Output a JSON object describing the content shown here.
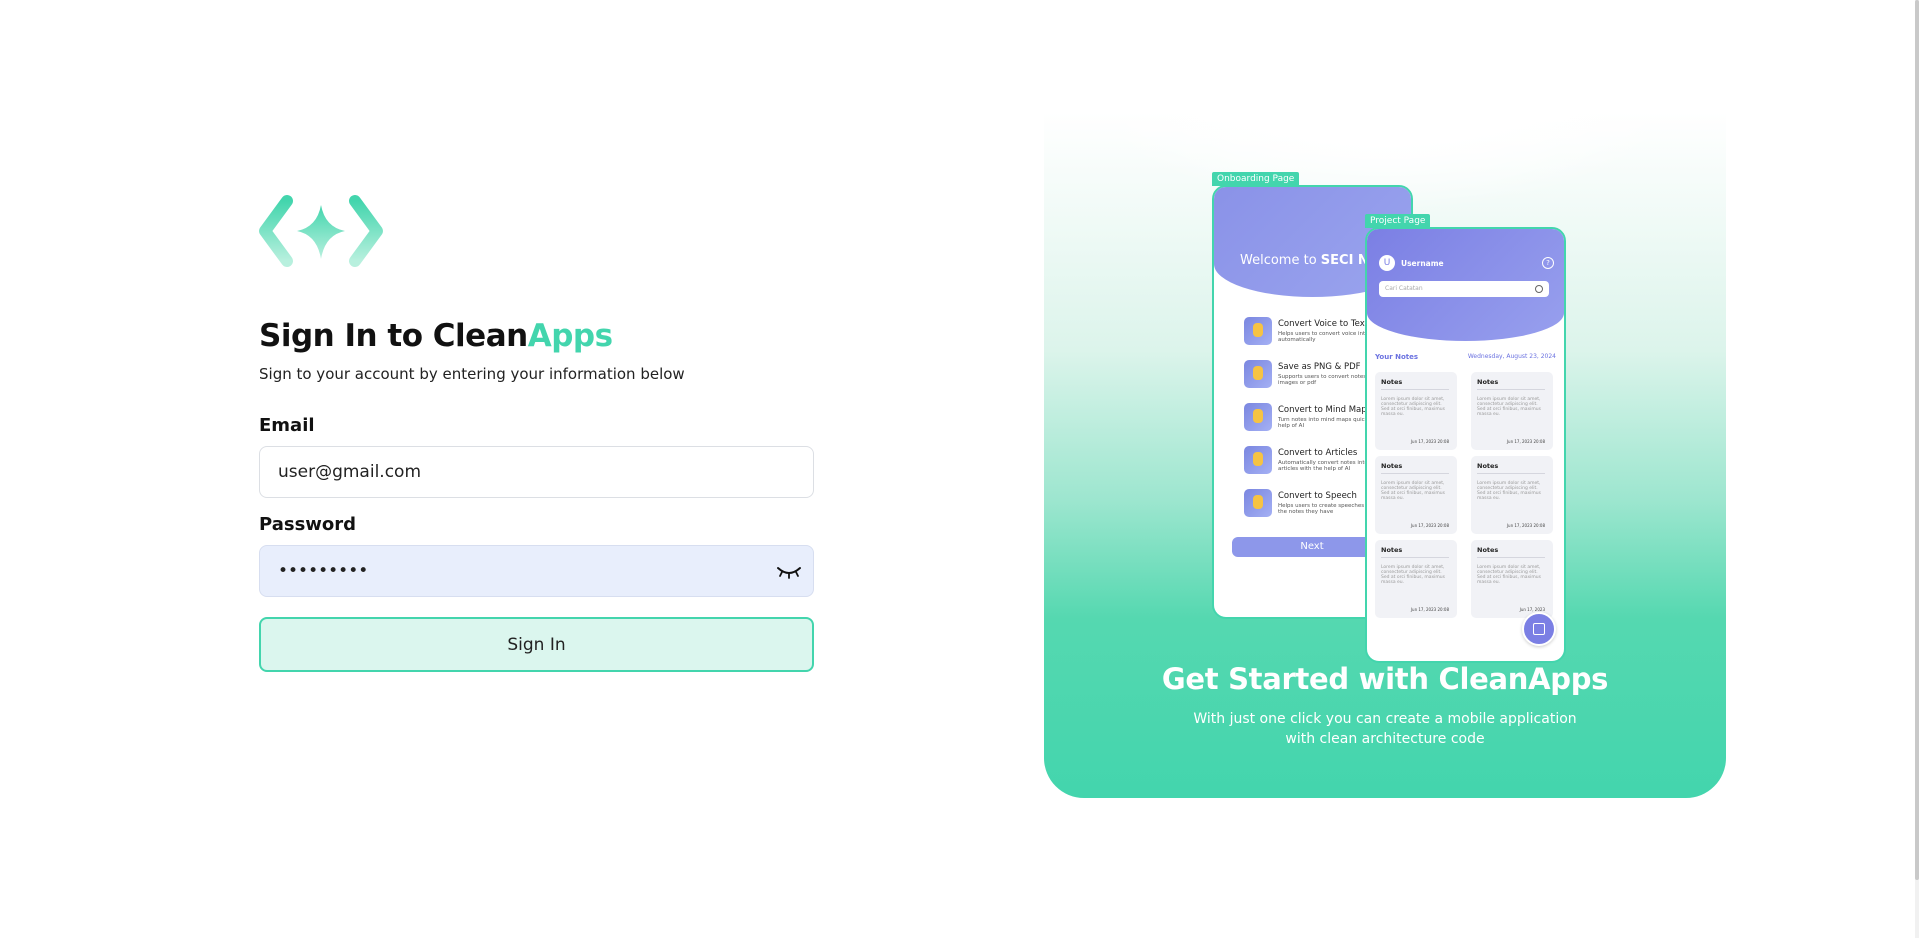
{
  "brand": {
    "logo_icon": "diamond-chevrons-logo",
    "accent_color": "#43d5ad"
  },
  "form": {
    "title_prefix": "Sign In to Clean",
    "title_accent": "Apps",
    "subtitle": "Sign to your account by entering your information below",
    "email_label": "Email",
    "email_value": "user@gmail.com",
    "password_label": "Password",
    "password_value": "•••••••••",
    "password_toggle_icon": "eye-closed-icon",
    "submit_label": "Sign In"
  },
  "showcase": {
    "onboarding_tag": "Onboarding Page",
    "project_tag": "Project Page",
    "onboarding": {
      "welcome_prefix": "Welcome to ",
      "welcome_brand": "SECI No",
      "features": [
        {
          "title": "Convert Voice to Text",
          "desc": "Helps users to convert voice into text automatically"
        },
        {
          "title": "Save as PNG & PDF",
          "desc": "Supports users to convert notes into images or pdf"
        },
        {
          "title": "Convert to Mind Map",
          "desc": "Turn notes into mind maps quickly with the help of AI"
        },
        {
          "title": "Convert to Articles",
          "desc": "Automatically convert notes into complete articles with the help of AI"
        },
        {
          "title": "Convert to Speech",
          "desc": "Helps users to create speeches based on the notes they have"
        }
      ],
      "next_label": "Next"
    },
    "project": {
      "avatar_letter": "U",
      "username": "Username",
      "help_icon": "?",
      "search_placeholder": "Cari Catatan",
      "your_notes": "Your Notes",
      "date": "Wednesday, August 23, 2024",
      "notes": [
        {
          "title": "Notes",
          "body": "Lorem ipsum dolor sit amet, consectetur adipiscing elit. Sed at orci finibus, maximus massa eu.",
          "date": "Jun 17, 2023 20:08"
        },
        {
          "title": "Notes",
          "body": "Lorem ipsum dolor sit amet, consectetur adipiscing elit. Sed at orci finibus, maximus massa eu.",
          "date": "Jun 17, 2023 20:08"
        },
        {
          "title": "Notes",
          "body": "Lorem ipsum dolor sit amet, consectetur adipiscing elit. Sed at orci finibus, maximus massa eu.",
          "date": "Jun 17, 2023 20:08"
        },
        {
          "title": "Notes",
          "body": "Lorem ipsum dolor sit amet, consectetur adipiscing elit. Sed at orci finibus, maximus massa eu.",
          "date": "Jun 17, 2023 20:08"
        },
        {
          "title": "Notes",
          "body": "Lorem ipsum dolor sit amet, consectetur adipiscing elit. Sed at orci finibus, maximus massa eu.",
          "date": "Jun 17, 2023 20:08"
        },
        {
          "title": "Notes",
          "body": "Lorem ipsum dolor sit amet, consectetur adipiscing elit. Sed at orci finibus, maximus massa eu.",
          "date": "Jun 17, 2023"
        }
      ]
    },
    "title": "Get Started with CleanApps",
    "subtitle": "With just one click you can create a mobile application with clean architecture code"
  }
}
